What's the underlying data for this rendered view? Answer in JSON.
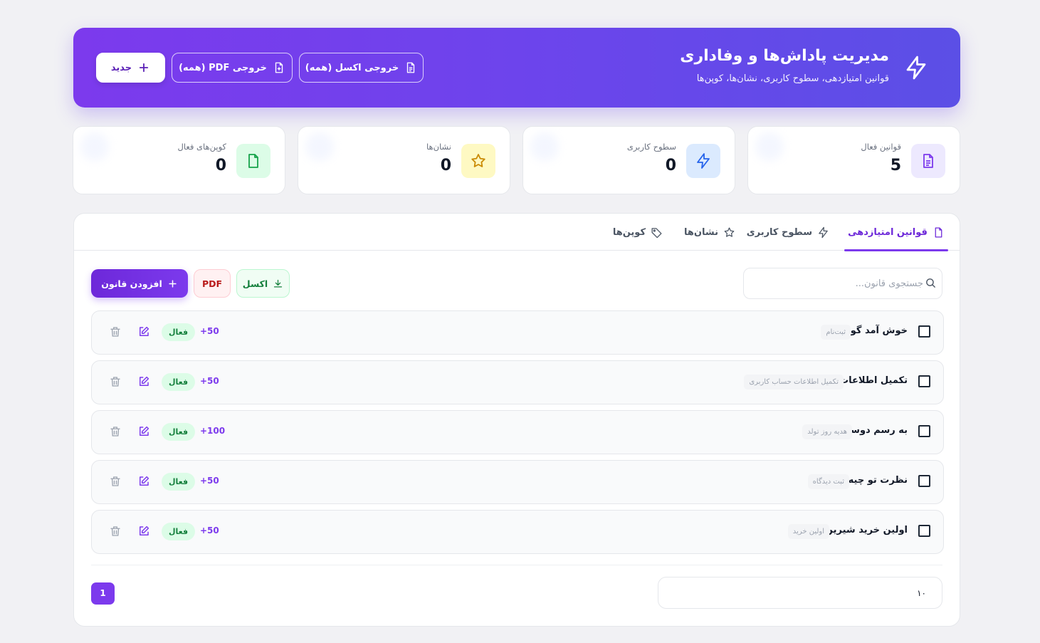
{
  "header": {
    "title": "مدیریت پاداش‌ها و وفاداری",
    "subtitle": "قوانین امتیازدهی، سطوح کاربری، نشان‌ها، کوپن‌ها",
    "excel_all_label": "خروجی اکسل (همه)",
    "pdf_all_label": "خروجی PDF (همه)",
    "new_label": "جدید"
  },
  "stats": [
    {
      "label": "قوانین فعال",
      "value": "5",
      "icon": "document-icon",
      "color": "#7c3aed",
      "bg": "#ede9fe"
    },
    {
      "label": "سطوح کاربری",
      "value": "0",
      "icon": "bolt-icon",
      "color": "#2563eb",
      "bg": "#dbeafe"
    },
    {
      "label": "نشان‌ها",
      "value": "0",
      "icon": "star-icon",
      "color": "#ca8a04",
      "bg": "#fef9c3"
    },
    {
      "label": "کوپن‌های فعال",
      "value": "0",
      "icon": "file-icon",
      "color": "#16a34a",
      "bg": "#dcfce7"
    }
  ],
  "tabs": [
    {
      "label": "قوانین امتیازدهی",
      "icon": "document-icon",
      "active": true
    },
    {
      "label": "سطوح کاربری",
      "icon": "bolt-icon",
      "active": false
    },
    {
      "label": "نشان‌ها",
      "icon": "star-icon",
      "active": false
    },
    {
      "label": "کوپن‌ها",
      "icon": "tag-icon",
      "active": false
    }
  ],
  "toolbar": {
    "search_placeholder": "جستجوی قانون...",
    "excel_label": "اکسل",
    "pdf_label": "PDF",
    "add_label": "افزودن قانون"
  },
  "rules": [
    {
      "title": "خوش آمد گویی",
      "tag": "ثبت‌نام",
      "points": "+50",
      "status": "فعال"
    },
    {
      "title": "تکمیل اطلاعات",
      "tag": "تکمیل اطلاعات حساب کاربری",
      "points": "+50",
      "status": "فعال"
    },
    {
      "title": "به رسم دوستی!",
      "tag": "هدیه روز تولد",
      "points": "+100",
      "status": "فعال"
    },
    {
      "title": "نظرت تو چیه؟",
      "tag": "ثبت دیدگاه",
      "points": "+50",
      "status": "فعال"
    },
    {
      "title": "اولین خرید شیرین!",
      "tag": "اولین خرید",
      "points": "+50",
      "status": "فعال"
    }
  ],
  "pagination": {
    "per_page": "۱۰",
    "current_page": "1"
  },
  "colors": {
    "accent": "#7c3aed",
    "success": "#16a34a",
    "danger": "#b91c1c"
  }
}
